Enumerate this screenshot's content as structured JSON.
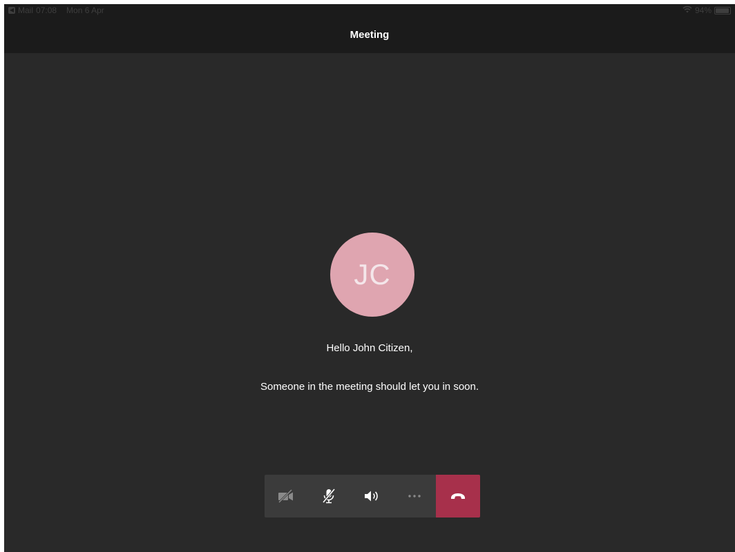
{
  "status_bar": {
    "back_app": "Mail",
    "time": "07:08",
    "date": "Mon 6 Apr",
    "battery": "94%",
    "battery_level": 0.94
  },
  "nav": {
    "title": "Meeting"
  },
  "lobby": {
    "avatar_initials": "JC",
    "avatar_color": "#dfa5b0",
    "greeting": "Hello John Citizen,",
    "message": "Someone in the meeting should let you in soon."
  },
  "controls": {
    "icons": [
      "video-off-icon",
      "mic-off-icon",
      "speaker-icon",
      "more-icon",
      "hang-up-icon"
    ],
    "hangup_color": "#a7304b"
  }
}
